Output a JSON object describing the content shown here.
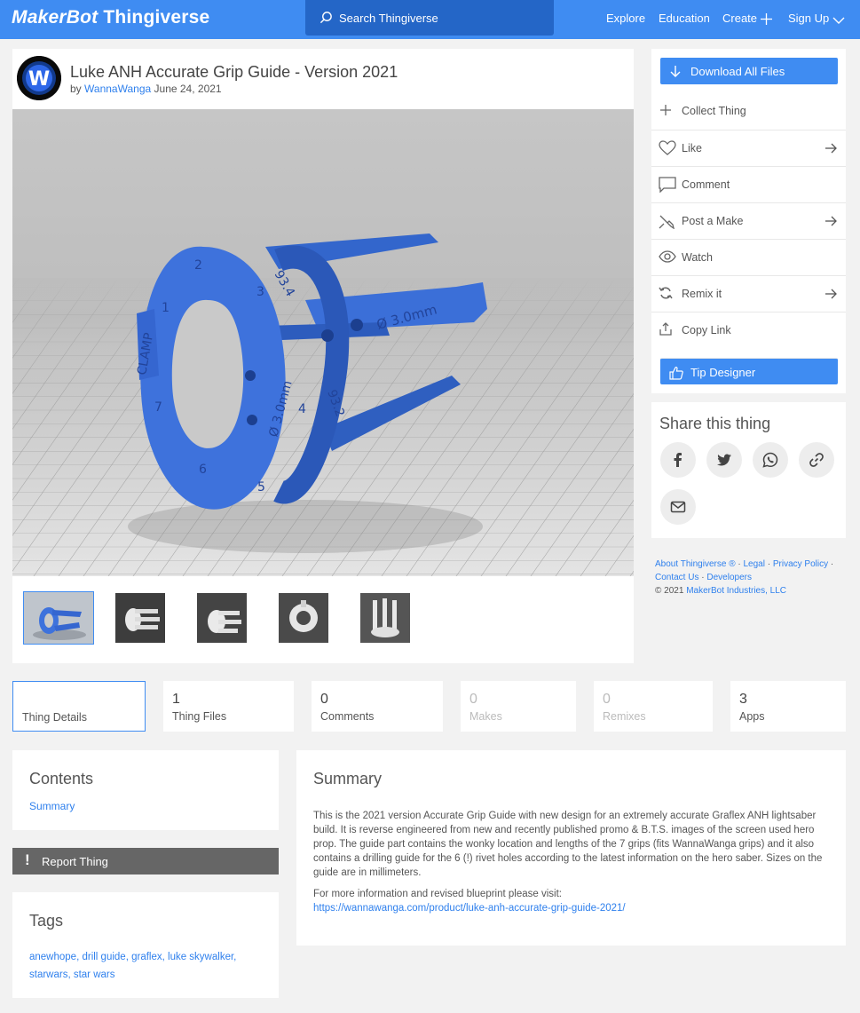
{
  "header": {
    "logo_part1": "MakerBot",
    "logo_part2": "Thingiverse",
    "search_placeholder": "Search Thingiverse",
    "nav": [
      "Explore",
      "Education",
      "Create",
      "Sign Up"
    ]
  },
  "thing": {
    "title": "Luke ANH Accurate Grip Guide - Version 2021",
    "by_label": "by",
    "author": "WannaWanga",
    "date": "June 24, 2021",
    "avatar_letter": "W",
    "image_labels": [
      "CLAMP",
      "Ø 3.0mm",
      "Ø 3.0mm",
      "93.4",
      "93.2",
      "1",
      "2",
      "3",
      "4",
      "5",
      "6",
      "7"
    ]
  },
  "actions": {
    "download": "Download All Files",
    "collect": "Collect Thing",
    "like": "Like",
    "comment": "Comment",
    "post_make": "Post a Make",
    "watch": "Watch",
    "remix": "Remix it",
    "copy_link": "Copy Link",
    "tip": "Tip Designer"
  },
  "share": {
    "title": "Share this thing",
    "icons": [
      "facebook-icon",
      "twitter-icon",
      "whatsapp-icon",
      "link-icon",
      "mail-icon"
    ]
  },
  "footer": {
    "about": "About Thingiverse ®",
    "legal": "Legal",
    "privacy": "Privacy Policy",
    "contact": "Contact Us",
    "developers": "Developers",
    "copyright_prefix": "© 2021",
    "company": "MakerBot Industries, LLC",
    "sep": "·"
  },
  "tabs": [
    {
      "num": "",
      "label": "Thing Details"
    },
    {
      "num": "1",
      "label": "Thing Files"
    },
    {
      "num": "0",
      "label": "Comments"
    },
    {
      "num": "0",
      "label": "Makes"
    },
    {
      "num": "0",
      "label": "Remixes"
    },
    {
      "num": "3",
      "label": "Apps"
    }
  ],
  "contents": {
    "title": "Contents",
    "link": "Summary"
  },
  "report": "Report Thing",
  "tags": {
    "title": "Tags",
    "items": [
      "anewhope",
      "drill guide",
      "graflex",
      "luke skywalker",
      "starwars",
      "star wars"
    ]
  },
  "summary": {
    "title": "Summary",
    "paragraph1": "This is the 2021 version Accurate Grip Guide with new design for an extremely accurate Graflex ANH lightsaber build. It is reverse engineered from new and recently published promo & B.T.S. images of the screen used hero prop. The guide part contains the wonky location and lengths of the 7 grips (fits WannaWanga grips) and it also contains a drilling guide for the 6 (!) rivet holes according to the latest information on the hero saber. Sizes on the guide are in millimeters.",
    "paragraph2": "For more information and revised blueprint please visit:",
    "url": "https://wannawanga.com/product/luke-anh-accurate-grip-guide-2021/"
  },
  "colors": {
    "brand_blue": "#3f8cf2",
    "search_blue": "#2466c7",
    "link_blue": "#2f80ed",
    "model_blue": "#3b6fd8",
    "report_gray": "#666666"
  }
}
